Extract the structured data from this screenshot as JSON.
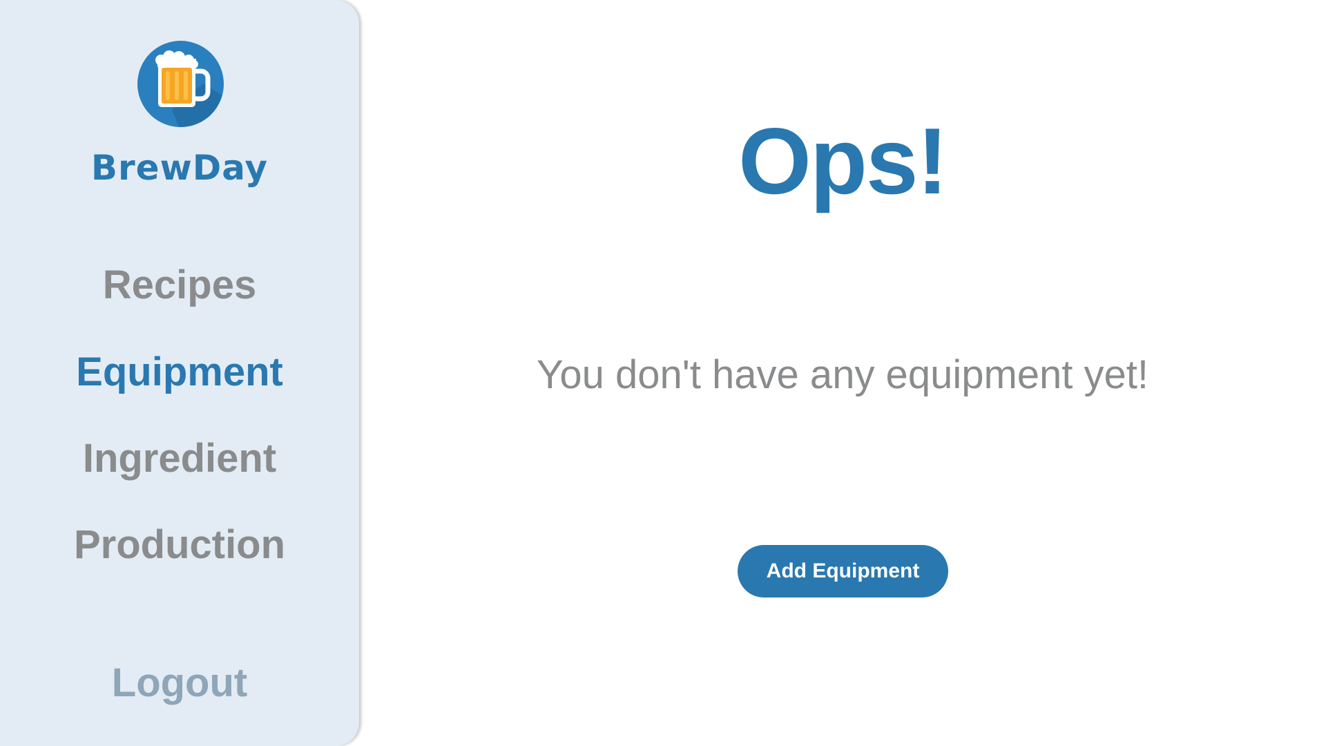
{
  "sidebar": {
    "logo_icon": "beer-mug-icon",
    "brand": "BrewDay",
    "items": [
      {
        "label": "Recipes",
        "active": false
      },
      {
        "label": "Equipment",
        "active": true
      },
      {
        "label": "Ingredient",
        "active": false
      },
      {
        "label": "Production",
        "active": false
      }
    ],
    "logout_label": "Logout"
  },
  "main": {
    "title": "Ops!",
    "message": "You don't have any equipment yet!",
    "add_button_label": "Add Equipment"
  },
  "colors": {
    "accent": "#2a78b0",
    "sidebar_bg": "#e3ecf4",
    "muted_text": "#8a8b8c",
    "logout_text": "#8fa6b9",
    "beer": "#f6a623"
  }
}
